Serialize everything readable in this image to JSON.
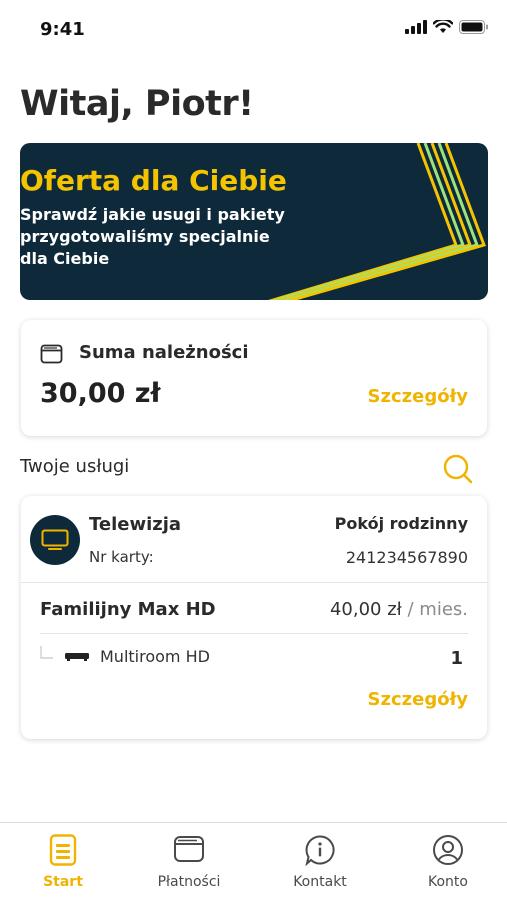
{
  "status_bar": {
    "time": "9:41"
  },
  "greeting": "Witaj, Piotr!",
  "banner": {
    "title": "Oferta dla Ciebie",
    "text": "Sprawdź jakie usugi i pakiety przygotowaliśmy specjalnie dla Ciebie"
  },
  "dues": {
    "title": "Suma należności",
    "amount": "30,00 zł",
    "details_link": "Szczegóły"
  },
  "services_section": {
    "title": "Twoje usługi"
  },
  "service": {
    "name": "Telewizja",
    "room": "Pokój rodzinny",
    "card_label": "Nr karty:",
    "card_number": "241234567890",
    "package_name": "Familijny Max HD",
    "package_price": "40,00 zł",
    "package_unit": " / mies.",
    "addon_name": "Multiroom HD",
    "addon_quantity": "1",
    "details_link": "Szczegóły"
  },
  "tabs": [
    {
      "label": "Start",
      "icon": "document-icon",
      "active": true
    },
    {
      "label": "Płatności",
      "icon": "wallet-icon",
      "active": false
    },
    {
      "label": "Kontakt",
      "icon": "info-chat-icon",
      "active": false
    },
    {
      "label": "Konto",
      "icon": "user-icon",
      "active": false
    }
  ],
  "colors": {
    "accent": "#f0b400",
    "banner_bg": "#0e2a3a",
    "banner_title": "#f5c400",
    "stripe_colors": [
      "#f5c400",
      "#9be37a",
      "#f5c400",
      "#9be37a",
      "#f5c400"
    ]
  }
}
